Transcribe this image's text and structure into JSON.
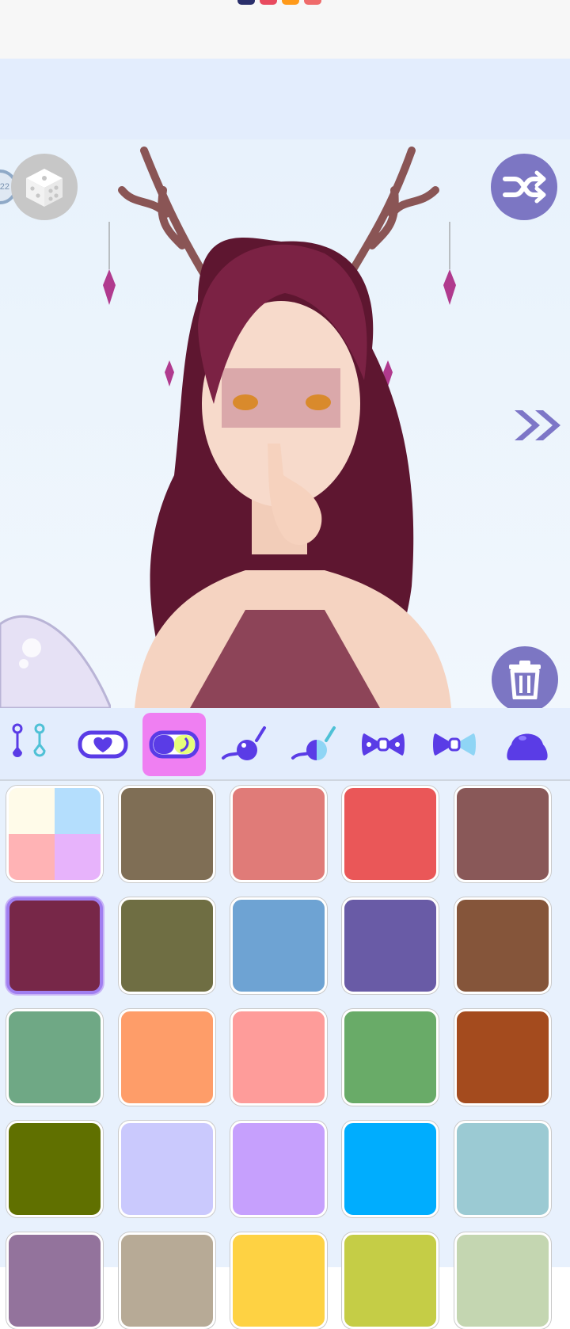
{
  "status_bar": {
    "dot_colors": [
      "#2a2f6b",
      "#e84a5f",
      "#ff9a1a",
      "#ef6b6b"
    ]
  },
  "canvas": {
    "level_badge_text": "22",
    "buttons": {
      "random": "dice-icon",
      "shuffle": "shuffle-icon",
      "delete": "trash-icon",
      "next": "double-chevron-right-icon"
    }
  },
  "category_tabs": [
    {
      "icon": "earring-icon",
      "active": false
    },
    {
      "icon": "heart-mask-icon",
      "active": false
    },
    {
      "icon": "half-mask-icon",
      "active": true
    },
    {
      "icon": "horn-icon",
      "active": false
    },
    {
      "icon": "horn-color-icon",
      "active": false
    },
    {
      "icon": "bow-icon",
      "active": false
    },
    {
      "icon": "bow-color-icon",
      "active": false
    },
    {
      "icon": "slime-icon",
      "active": false
    }
  ],
  "swatches": [
    {
      "colors": [
        "#fffbe9",
        "#b4defd",
        "#ffb3b5",
        "#e7b3fb"
      ],
      "selected": false
    },
    {
      "colors": [
        "#7f6e55"
      ],
      "selected": false
    },
    {
      "colors": [
        "#e07b78"
      ],
      "selected": false
    },
    {
      "colors": [
        "#ea5758"
      ],
      "selected": false
    },
    {
      "colors": [
        "#895858"
      ],
      "selected": false
    },
    {
      "colors": [
        "#772748"
      ],
      "selected": true
    },
    {
      "colors": [
        "#6f6e43"
      ],
      "selected": false
    },
    {
      "colors": [
        "#6ea3d3"
      ],
      "selected": false
    },
    {
      "colors": [
        "#695ba6"
      ],
      "selected": false
    },
    {
      "colors": [
        "#85553a"
      ],
      "selected": false
    },
    {
      "colors": [
        "#6fa885"
      ],
      "selected": false
    },
    {
      "colors": [
        "#fe9d69"
      ],
      "selected": false
    },
    {
      "colors": [
        "#fe9c9a"
      ],
      "selected": false
    },
    {
      "colors": [
        "#69ab68"
      ],
      "selected": false
    },
    {
      "colors": [
        "#a44b1e"
      ],
      "selected": false
    },
    {
      "colors": [
        "#607000"
      ],
      "selected": false
    },
    {
      "colors": [
        "#cac9fd"
      ],
      "selected": false
    },
    {
      "colors": [
        "#c6a0fd"
      ],
      "selected": false
    },
    {
      "colors": [
        "#00adfe"
      ],
      "selected": false
    },
    {
      "colors": [
        "#9bcad3"
      ],
      "selected": false
    },
    {
      "colors": [
        "#93739c"
      ],
      "selected": false
    },
    {
      "colors": [
        "#b7aa96"
      ],
      "selected": false
    },
    {
      "colors": [
        "#fed243"
      ],
      "selected": false
    },
    {
      "colors": [
        "#c5cd46"
      ],
      "selected": false
    },
    {
      "colors": [
        "#c4d6b1"
      ],
      "selected": false
    }
  ]
}
